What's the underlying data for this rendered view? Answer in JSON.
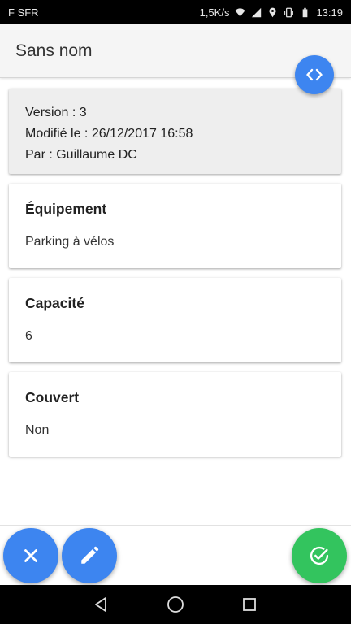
{
  "status_bar": {
    "carrier": "F SFR",
    "network_speed": "1,5K/s",
    "time": "13:19",
    "icons": [
      "wifi-icon",
      "signal-icon",
      "location-icon",
      "vibrate-icon",
      "battery-icon"
    ]
  },
  "app_bar": {
    "title": "Sans nom",
    "code_button_icon": "code-icon"
  },
  "meta": {
    "version": "Version : 3",
    "modified": "Modifié le : 26/12/2017 16:58",
    "author": "Par : Guillaume DC"
  },
  "fields": [
    {
      "label": "Équipement",
      "value": "Parking à vélos"
    },
    {
      "label": "Capacité",
      "value": "6"
    },
    {
      "label": "Couvert",
      "value": "Non"
    }
  ],
  "actions": {
    "close_icon": "close-icon",
    "edit_icon": "edit-icon",
    "confirm_icon": "check-circle-icon"
  },
  "nav": {
    "icons": [
      "back-icon",
      "home-icon",
      "recents-icon"
    ]
  },
  "colors": {
    "accent_blue": "#3d85f0",
    "confirm_green": "#33c45e",
    "app_bar_bg": "#f5f5f5",
    "meta_card_bg": "#eeeeee"
  }
}
